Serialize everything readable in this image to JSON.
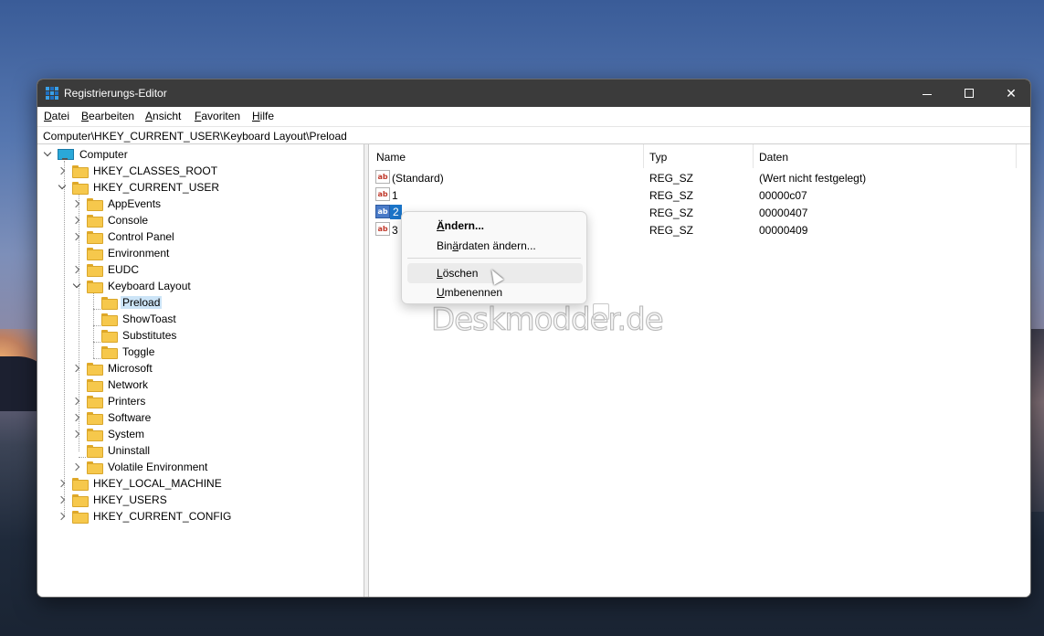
{
  "window": {
    "title": "Registrierungs-Editor",
    "min_glyph": "—",
    "max_glyph": "☐",
    "close_glyph": "✕"
  },
  "menu": {
    "items": [
      {
        "prefix": "",
        "accel": "D",
        "rest": "atei"
      },
      {
        "prefix": "",
        "accel": "B",
        "rest": "earbeiten"
      },
      {
        "prefix": "",
        "accel": "A",
        "rest": "nsicht"
      },
      {
        "prefix": "",
        "accel": "F",
        "rest": "avoriten"
      },
      {
        "prefix": "",
        "accel": "H",
        "rest": "ilfe"
      }
    ]
  },
  "address": {
    "path": "Computer\\HKEY_CURRENT_USER\\Keyboard Layout\\Preload"
  },
  "tree": {
    "computer": "Computer",
    "hkcr": "HKEY_CLASSES_ROOT",
    "hkcu": "HKEY_CURRENT_USER",
    "appevents": "AppEvents",
    "console": "Console",
    "control_panel": "Control Panel",
    "environment": "Environment",
    "eudc": "EUDC",
    "keyboard_layout": "Keyboard Layout",
    "preload": "Preload",
    "showtoast": "ShowToast",
    "substitutes": "Substitutes",
    "toggle": "Toggle",
    "microsoft": "Microsoft",
    "network": "Network",
    "printers": "Printers",
    "software": "Software",
    "system": "System",
    "uninstall": "Uninstall",
    "volatile_environment": "Volatile Environment",
    "hklm": "HKEY_LOCAL_MACHINE",
    "hku": "HKEY_USERS",
    "hkcc": "HKEY_CURRENT_CONFIG"
  },
  "list": {
    "headers": {
      "name": "Name",
      "typ": "Typ",
      "daten": "Daten"
    },
    "icon_text": "ab",
    "rows": [
      {
        "name": "(Standard)",
        "typ": "REG_SZ",
        "daten": "(Wert nicht festgelegt)"
      },
      {
        "name": "1",
        "typ": "REG_SZ",
        "daten": "00000c07"
      },
      {
        "name": "2",
        "typ": "REG_SZ",
        "daten": "00000407"
      },
      {
        "name": "3",
        "typ": "REG_SZ",
        "daten": "00000409"
      }
    ],
    "selected_row": 2
  },
  "context_menu": {
    "items": [
      {
        "accel": "Ä",
        "rest": "ndern...",
        "bold": true
      },
      {
        "pre": "Bin",
        "accel": "ä",
        "rest": "rdaten ändern..."
      },
      {
        "accel": "L",
        "rest": "öschen",
        "hover": true
      },
      {
        "accel": "U",
        "rest": "mbenennen"
      }
    ]
  },
  "watermark": "Deskmodder.de"
}
